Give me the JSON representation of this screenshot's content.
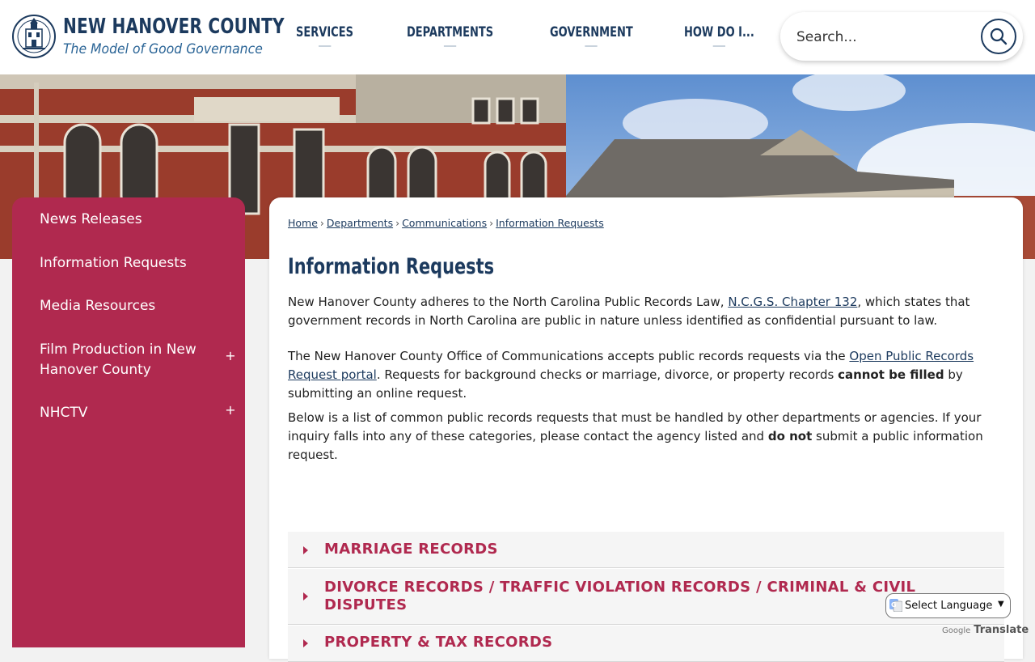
{
  "header": {
    "site_name": "NEW HANOVER COUNTY",
    "tagline": "The Model of Good Governance",
    "nav": [
      {
        "label": "SERVICES"
      },
      {
        "label": "DEPARTMENTS"
      },
      {
        "label": "GOVERNMENT"
      },
      {
        "label": "HOW DO I..."
      }
    ],
    "search_placeholder": "Search..."
  },
  "sidebar": {
    "items": [
      {
        "label": "News Releases",
        "expandable": false
      },
      {
        "label": "Information Requests",
        "expandable": false
      },
      {
        "label": "Media Resources",
        "expandable": false
      },
      {
        "label": "Film Production in New Hanover County",
        "expandable": true,
        "toggle": "+"
      },
      {
        "label": "NHCTV",
        "expandable": true,
        "toggle": "+"
      }
    ]
  },
  "breadcrumb": {
    "items": [
      "Home",
      "Departments",
      "Communications",
      "Information Requests"
    ],
    "separator": "›"
  },
  "main": {
    "title": "Information Requests",
    "p1_pre": "New Hanover County adheres to the North Carolina Public Records Law, ",
    "p1_link": "N.C.G.S. Chapter 132",
    "p1_post": ", which states that government records in North Carolina are public in nature unless identified as confidential pursuant to law.",
    "p2_pre": "The New Hanover County Office of Communications accepts public records requests via the ",
    "p2_link": "Open Public Records Request portal",
    "p2_mid": ". Requests for background checks or marriage, divorce, or property records ",
    "p2_bold": "cannot be filled",
    "p2_post": " by submitting an online request.",
    "p3_pre": "Below is a list of common public records requests that must be handled by other departments or agencies. If your inquiry falls into any of these categories, please contact the agency listed and ",
    "p3_bold": "do not",
    "p3_post": " submit a public information request.",
    "accordion": [
      {
        "label": "MARRIAGE RECORDS"
      },
      {
        "label": "DIVORCE RECORDS / TRAFFIC VIOLATION RECORDS / CRIMINAL & CIVIL DISPUTES"
      },
      {
        "label": "PROPERTY & TAX RECORDS"
      }
    ]
  },
  "translate": {
    "select_label": "Select Language",
    "powered_by": "Google",
    "translate_label": "Translate"
  },
  "colors": {
    "navy": "#1c3a5e",
    "crimson": "#b0294f",
    "link_blue": "#2a6496"
  }
}
